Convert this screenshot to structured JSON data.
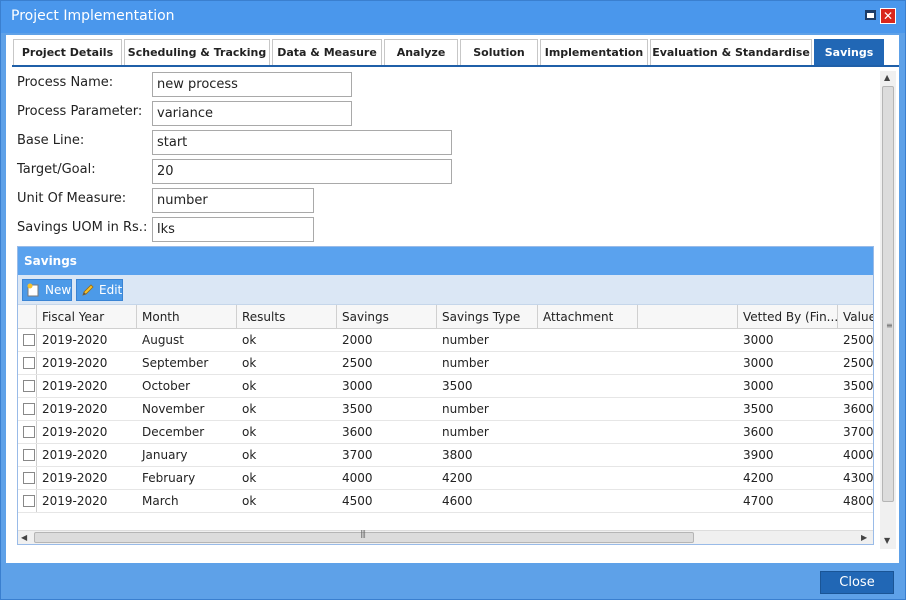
{
  "window": {
    "title": "Project Implementation",
    "close_symbol": "✕"
  },
  "tabs": [
    {
      "label": "Project Details"
    },
    {
      "label": "Scheduling & Tracking"
    },
    {
      "label": "Data & Measure"
    },
    {
      "label": "Analyze"
    },
    {
      "label": "Solution"
    },
    {
      "label": "Implementation"
    },
    {
      "label": "Evaluation & Standardise"
    },
    {
      "label": "Savings",
      "active": true
    }
  ],
  "form": {
    "process_name": {
      "label": "Process Name:",
      "value": "new process"
    },
    "process_parameter": {
      "label": "Process Parameter:",
      "value": "variance"
    },
    "base_line": {
      "label": "Base Line:",
      "value": "start"
    },
    "target_goal": {
      "label": "Target/Goal:",
      "value": "20"
    },
    "unit_of_measure": {
      "label": "Unit Of Measure:",
      "value": "number"
    },
    "savings_uom": {
      "label": "Savings UOM in Rs.:",
      "value": "lks"
    }
  },
  "savings_panel": {
    "title": "Savings",
    "new_label": "New",
    "edit_label": "Edit",
    "columns": [
      "Fiscal Year",
      "Month",
      "Results",
      "Savings",
      "Savings Type",
      "Attachment",
      "",
      "Vetted By (Fin...",
      "Value"
    ],
    "rows": [
      [
        "2019-2020",
        "August",
        "ok",
        "2000",
        "number",
        "",
        "",
        "3000",
        "2500"
      ],
      [
        "2019-2020",
        "September",
        "ok",
        "2500",
        "number",
        "",
        "",
        "3000",
        "2500"
      ],
      [
        "2019-2020",
        "October",
        "ok",
        "3000",
        "3500",
        "",
        "",
        "3000",
        "3500"
      ],
      [
        "2019-2020",
        "November",
        "ok",
        "3500",
        "number",
        "",
        "",
        "3500",
        "3600"
      ],
      [
        "2019-2020",
        "December",
        "ok",
        "3600",
        "number",
        "",
        "",
        "3600",
        "3700"
      ],
      [
        "2019-2020",
        "January",
        "ok",
        "3700",
        "3800",
        "",
        "",
        "3900",
        "4000"
      ],
      [
        "2019-2020",
        "February",
        "ok",
        "4000",
        "4200",
        "",
        "",
        "4200",
        "4300"
      ],
      [
        "2019-2020",
        "March",
        "ok",
        "4500",
        "4600",
        "",
        "",
        "4700",
        "4800"
      ]
    ]
  },
  "footer": {
    "close_label": "Close"
  },
  "colors": {
    "accent": "#2167b5",
    "header": "#4a97ec",
    "panel_header": "#5aa2ee"
  }
}
